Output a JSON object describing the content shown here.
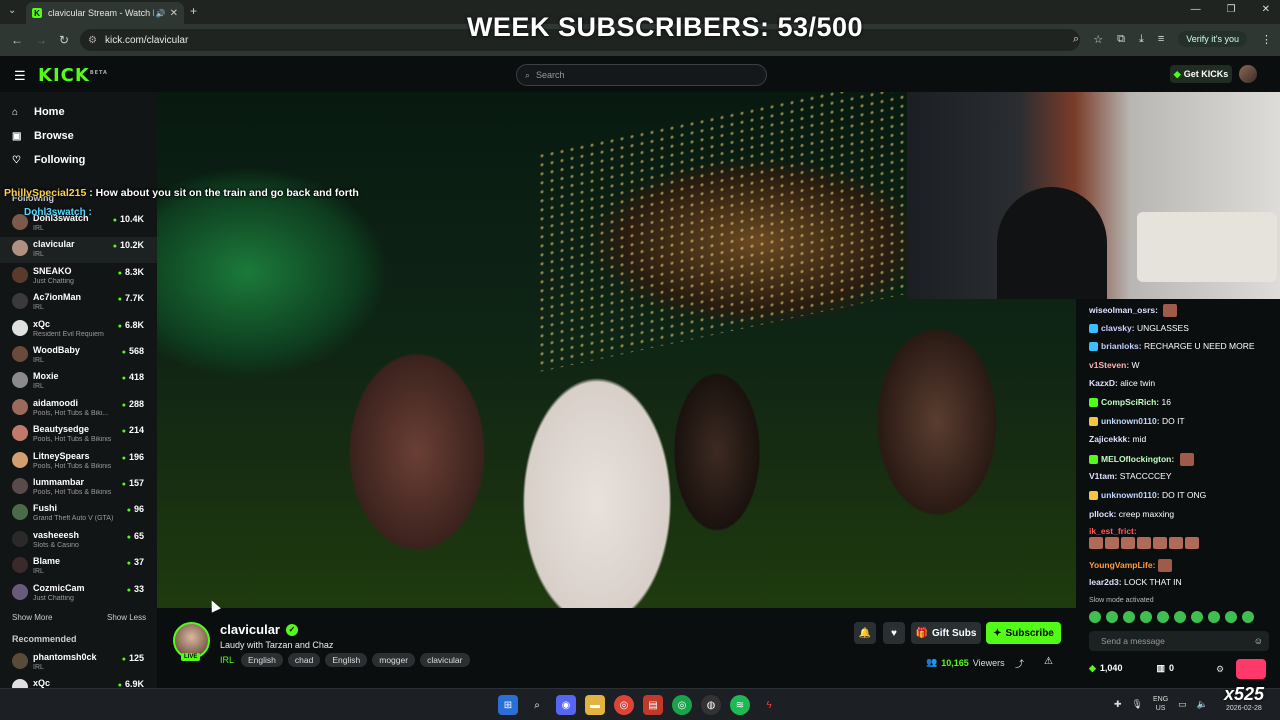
{
  "overlay": {
    "week_subs": "WEEK SUBSCRIBERS: 53/500",
    "chat_user": "PhillySpecial215",
    "chat_msg": ": How about you sit on the train and go back and forth",
    "chat_user2": "Dohl3swatch :",
    "watermark": "x525"
  },
  "browser": {
    "tab_title": "clavicular Stream - Watch Li",
    "url": "kick.com/clavicular",
    "verify_label": "Verify it's you"
  },
  "header": {
    "logo": "KICK",
    "logo_badge": "BETA",
    "search_placeholder": "Search",
    "get_kicks": "Get KICKs"
  },
  "sidebar": {
    "nav": [
      {
        "label": "Home",
        "icon": "home-icon"
      },
      {
        "label": "Browse",
        "icon": "compass-icon"
      },
      {
        "label": "Following",
        "icon": "heart-icon"
      }
    ],
    "following_label": "Following",
    "following": [
      {
        "name": "Dohl3swatch",
        "category": "IRL",
        "viewers": "10.4K",
        "color": "#7a5a4a"
      },
      {
        "name": "clavicular",
        "category": "IRL",
        "viewers": "10.2K",
        "color": "#b09080"
      },
      {
        "name": "SNEAKO",
        "category": "Just Chatting",
        "viewers": "8.3K",
        "color": "#5a3a2a"
      },
      {
        "name": "Ac7ionMan",
        "category": "IRL",
        "viewers": "7.7K",
        "color": "#3a3a3a"
      },
      {
        "name": "xQc",
        "category": "Resident Evil Requiem",
        "viewers": "6.8K",
        "color": "#e0e0e0"
      },
      {
        "name": "WoodBaby",
        "category": "IRL",
        "viewers": "568",
        "color": "#6a4a3a"
      },
      {
        "name": "Moxie",
        "category": "IRL",
        "viewers": "418",
        "color": "#8a8a8a"
      },
      {
        "name": "aidamoodi",
        "category": "Pools, Hot Tubs & Biki...",
        "viewers": "288",
        "color": "#9a6a5a"
      },
      {
        "name": "Beautysedge",
        "category": "Pools, Hot Tubs & Bikinis",
        "viewers": "214",
        "color": "#c07a6a"
      },
      {
        "name": "LitneySpears",
        "category": "Pools, Hot Tubs & Bikinis",
        "viewers": "196",
        "color": "#d0a070"
      },
      {
        "name": "lummambar",
        "category": "Pools, Hot Tubs & Bikinis",
        "viewers": "157",
        "color": "#5a4a4a"
      },
      {
        "name": "Fushi",
        "category": "Grand Theft Auto V (GTA)",
        "viewers": "96",
        "color": "#4a6a4a"
      },
      {
        "name": "vasheeesh",
        "category": "Slots & Casino",
        "viewers": "65",
        "color": "#2a2a2a"
      },
      {
        "name": "Blame",
        "category": "IRL",
        "viewers": "37",
        "color": "#3a2a2a"
      },
      {
        "name": "CozmicCam",
        "category": "Just Chatting",
        "viewers": "33",
        "color": "#6a5a7a"
      }
    ],
    "show_more": "Show More",
    "show_less": "Show Less",
    "recommended_label": "Recommended",
    "recommended": [
      {
        "name": "phantomsh0ck",
        "category": "IRL",
        "viewers": "125",
        "color": "#5a4a3a"
      },
      {
        "name": "xQc",
        "category": "",
        "viewers": "6.9K",
        "color": "#e0e0e0"
      }
    ]
  },
  "stream": {
    "name": "clavicular",
    "title": "Laudy with Tarzan and Chaz",
    "live": "LIVE",
    "category": "IRL",
    "tags": [
      "English",
      "chad",
      "English",
      "mogger",
      "clavicular"
    ],
    "gift_label": "Gift Subs",
    "subscribe_label": "Subscribe",
    "viewers": "10,165",
    "viewers_label": "Viewers"
  },
  "chat": {
    "messages": [
      {
        "user": "wiseolman_osrs:",
        "text": "",
        "color": "#e0e0ff",
        "badge": "",
        "emote": true
      },
      {
        "user": "clavsky:",
        "text": "UNGLASSES",
        "color": "#d0d0ff",
        "badge": "b",
        "emote": false
      },
      {
        "user": "brianloks:",
        "text": "RECHARGE U NEED MORE",
        "color": "#c0d0ff",
        "badge": "b",
        "emote": false
      },
      {
        "user": "v1Steven:",
        "text": "W",
        "color": "#ffb0b0",
        "badge": "",
        "emote": false
      },
      {
        "user": "KazxD:",
        "text": "alice twin",
        "color": "#e0e0ff",
        "badge": "",
        "emote": false
      },
      {
        "user": "CompSciRich:",
        "text": "16",
        "color": "#c0ffc0",
        "badge": "g",
        "emote": false
      },
      {
        "user": "unknown0110:",
        "text": "DO IT",
        "color": "#c0d8ff",
        "badge": "y",
        "emote": false
      },
      {
        "user": "Zajicekkk:",
        "text": "mid",
        "color": "#e0e0ff",
        "badge": "",
        "emote": false
      },
      {
        "user": "MELOflockington:",
        "text": "",
        "color": "#c0ffc0",
        "badge": "g",
        "emote": true
      },
      {
        "user": "V1tam:",
        "text": "STACCCCEY",
        "color": "#e0e0ff",
        "badge": "",
        "emote": false
      },
      {
        "user": "unknown0110:",
        "text": "DO IT ONG",
        "color": "#c0d8ff",
        "badge": "y",
        "emote": false
      },
      {
        "user": "pllock:",
        "text": "creep maxxing",
        "color": "#e0e0ff",
        "badge": "",
        "emote": false
      }
    ],
    "emote_user": "ik_est_frict:",
    "young_user": "YoungVampLife:",
    "last_user": "lear2d3:",
    "last_text": "LOCK THAT IN",
    "slow_mode": "Slow mode activated",
    "send_placeholder": "Send a message",
    "kicks_count": "1,040",
    "other_count": "0"
  },
  "taskbar": {
    "lang_top": "ENG",
    "lang_bottom": "US",
    "date": "2026-02-28"
  }
}
